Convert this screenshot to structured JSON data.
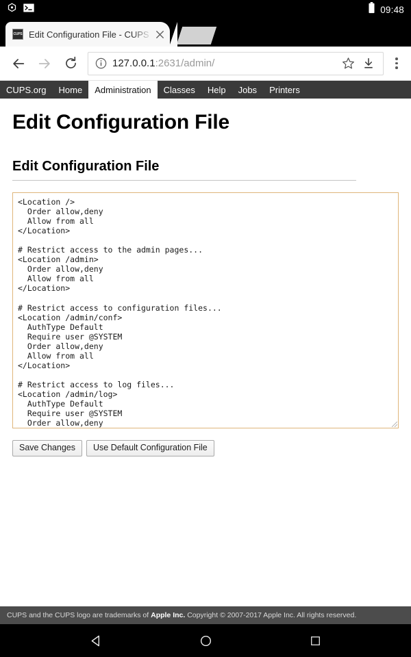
{
  "status_bar": {
    "icons": [
      "alarm-icon",
      "terminal-icon"
    ],
    "battery_icon": "battery-full-icon",
    "clock": "09:48"
  },
  "browser": {
    "tab": {
      "favicon_label": "CUPS",
      "title": "Edit Configuration File - CUPS",
      "close_label": "✕"
    },
    "background_tab_present": true,
    "toolbar": {
      "back_icon": "back-arrow-icon",
      "forward_icon": "forward-arrow-icon",
      "reload_icon": "reload-icon",
      "site_info_icon": "info-circle-icon",
      "url_host": "127.0.0.1",
      "url_path": ":2631/admin/",
      "bookmark_icon": "star-icon",
      "download_icon": "download-icon",
      "menu_icon": "overflow-menu-icon"
    }
  },
  "cups_nav": {
    "items": [
      {
        "label": "CUPS.org",
        "active": false
      },
      {
        "label": "Home",
        "active": false
      },
      {
        "label": "Administration",
        "active": true
      },
      {
        "label": "Classes",
        "active": false
      },
      {
        "label": "Help",
        "active": false
      },
      {
        "label": "Jobs",
        "active": false
      },
      {
        "label": "Printers",
        "active": false
      }
    ]
  },
  "main": {
    "page_title": "Edit Configuration File",
    "section_title": "Edit Configuration File",
    "editor_value": "<Location />\n  Order allow,deny\n  Allow from all\n</Location>\n\n# Restrict access to the admin pages...\n<Location /admin>\n  Order allow,deny\n  Allow from all\n</Location>\n\n# Restrict access to configuration files...\n<Location /admin/conf>\n  AuthType Default\n  Require user @SYSTEM\n  Order allow,deny\n  Allow from all\n</Location>\n\n# Restrict access to log files...\n<Location /admin/log>\n  AuthType Default\n  Require user @SYSTEM\n  Order allow,deny\n  Allow from all",
    "buttons": {
      "save": "Save Changes",
      "use_default": "Use Default Configuration File"
    }
  },
  "footer": {
    "text_before": "CUPS and the CUPS logo are trademarks of ",
    "trademark": "Apple Inc.",
    "text_after": " Copyright © 2007-2017 Apple Inc. All rights reserved."
  },
  "android_nav": {
    "back": "back-triangle-icon",
    "home": "home-circle-icon",
    "recents": "recents-square-icon"
  },
  "colors": {
    "status_bar_bg": "#000000",
    "cups_nav_bg": "#3a3a3a",
    "cups_footer_bg": "#4c4c4c",
    "editor_border": "#dfb57a",
    "url_dim": "#9a9a9a"
  }
}
